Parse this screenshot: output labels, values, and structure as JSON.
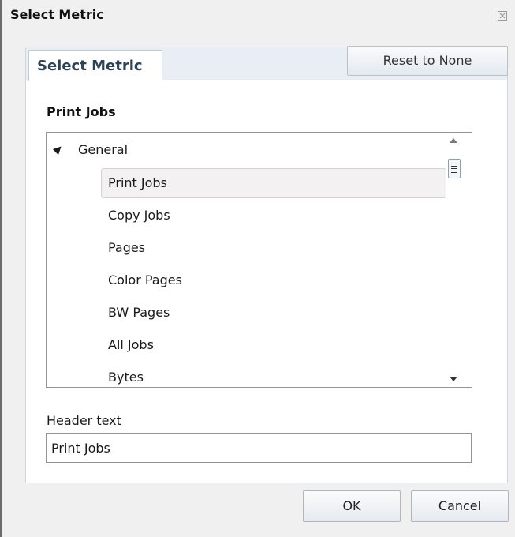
{
  "dialog": {
    "title": "Select Metric",
    "close_icon": "close-icon"
  },
  "tabs": [
    {
      "label": "Select Metric",
      "active": true
    }
  ],
  "reset_button": "Reset to None",
  "selected_metric": "Print Jobs",
  "tree": {
    "group": {
      "label": "General",
      "expanded": true,
      "icon": "expand-triangle-icon"
    },
    "items": [
      {
        "label": "Print Jobs",
        "selected": true
      },
      {
        "label": "Copy Jobs"
      },
      {
        "label": "Pages"
      },
      {
        "label": "Color Pages"
      },
      {
        "label": "BW Pages"
      },
      {
        "label": "All Jobs"
      },
      {
        "label": "Bytes"
      }
    ]
  },
  "header_field": {
    "label": "Header text",
    "value": "Print Jobs"
  },
  "buttons": {
    "ok": "OK",
    "cancel": "Cancel"
  },
  "colors": {
    "tab_text": "#2b4257",
    "selection_bg": "#f3f1f1",
    "panel_border": "#cfd6de"
  }
}
